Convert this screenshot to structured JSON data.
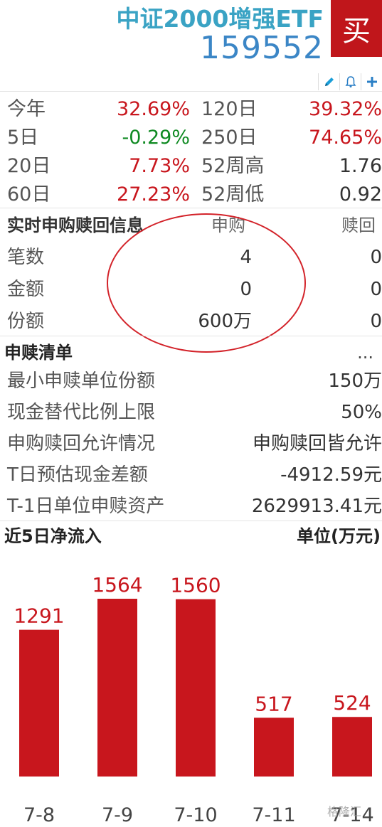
{
  "header": {
    "fund_name": "中证2000增强ETF",
    "fund_code": "159552",
    "buy_label": "买",
    "tools": [
      "edit-icon",
      "bell-icon",
      "plus-icon"
    ]
  },
  "performance": [
    {
      "label1": "今年",
      "value1": "32.69%",
      "color1": "red",
      "label2": "120日",
      "value2": "39.32%",
      "color2": "red"
    },
    {
      "label1": "5日",
      "value1": "-0.29%",
      "color1": "green",
      "label2": "250日",
      "value2": "74.65%",
      "color2": "red"
    },
    {
      "label1": "20日",
      "value1": "7.73%",
      "color1": "red",
      "label2": "52周高",
      "value2": "1.76",
      "color2": "dark"
    },
    {
      "label1": "60日",
      "value1": "27.23%",
      "color1": "red",
      "label2": "52周低",
      "value2": "0.92",
      "color2": "dark"
    }
  ],
  "realtime": {
    "title": "实时申购赎回信息",
    "col_sub": "申购",
    "col_red": "赎回",
    "rows": [
      {
        "label": "笔数",
        "sub": "4",
        "red": "0"
      },
      {
        "label": "金额",
        "sub": "0",
        "red": "0"
      },
      {
        "label": "份额",
        "sub": "600万",
        "red": "0"
      }
    ]
  },
  "list_section": {
    "title": "申赎清单",
    "more": "...",
    "rows": [
      {
        "label": "最小申赎单位份额",
        "value": "150万"
      },
      {
        "label": "现金替代比例上限",
        "value": "50%"
      },
      {
        "label": "申购赎回允许情况",
        "value": "申购赎回皆允许"
      },
      {
        "label": "T日预估现金差额",
        "value": "-4912.59元"
      },
      {
        "label": "T-1日单位申赎资产",
        "value": "2629913.41元"
      }
    ]
  },
  "flow": {
    "title": "近5日净流入",
    "unit": "单位(万元)"
  },
  "chart_data": {
    "type": "bar",
    "categories": [
      "7-8",
      "7-9",
      "7-10",
      "7-11",
      "7-14"
    ],
    "values": [
      1291,
      1564,
      1560,
      517,
      524
    ],
    "title": "近5日净流入",
    "xlabel": "",
    "ylabel": "单位(万元)",
    "ylim": [
      0,
      1564
    ],
    "bar_color": "#c8161d"
  },
  "colors": {
    "red": "#c8161d",
    "green": "#0f8a22",
    "accent": "#3aa3c4",
    "code": "#3b86c6",
    "buy_bg": "#c0161b"
  },
  "watermark": "格隆汇"
}
